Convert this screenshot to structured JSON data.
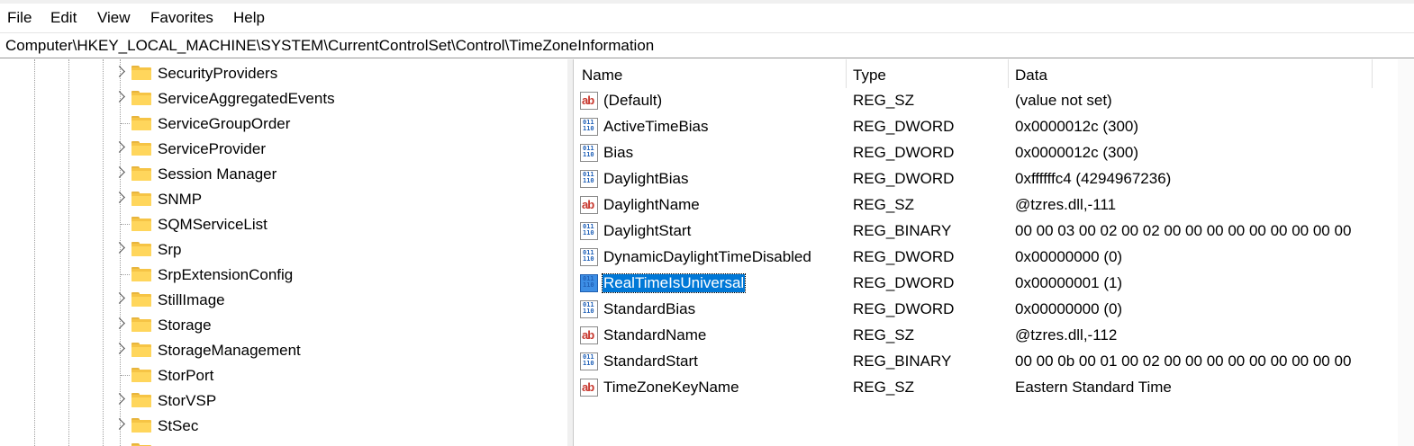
{
  "menu": [
    "File",
    "Edit",
    "View",
    "Favorites",
    "Help"
  ],
  "address": "Computer\\HKEY_LOCAL_MACHINE\\SYSTEM\\CurrentControlSet\\Control\\TimeZoneInformation",
  "tree": {
    "items": [
      {
        "label": "SecurityProviders",
        "expandable": true
      },
      {
        "label": "ServiceAggregatedEvents",
        "expandable": true
      },
      {
        "label": "ServiceGroupOrder",
        "expandable": false
      },
      {
        "label": "ServiceProvider",
        "expandable": true
      },
      {
        "label": "Session Manager",
        "expandable": true
      },
      {
        "label": "SNMP",
        "expandable": true
      },
      {
        "label": "SQMServiceList",
        "expandable": false
      },
      {
        "label": "Srp",
        "expandable": true
      },
      {
        "label": "SrpExtensionConfig",
        "expandable": false
      },
      {
        "label": "StillImage",
        "expandable": true
      },
      {
        "label": "Storage",
        "expandable": true
      },
      {
        "label": "StorageManagement",
        "expandable": true
      },
      {
        "label": "StorPort",
        "expandable": false
      },
      {
        "label": "StorVSP",
        "expandable": true
      },
      {
        "label": "StSec",
        "expandable": true
      }
    ]
  },
  "list": {
    "columns": [
      "Name",
      "Type",
      "Data"
    ],
    "rows": [
      {
        "name": "(Default)",
        "type": "REG_SZ",
        "data": "(value not set)",
        "icon": "string-value-icon"
      },
      {
        "name": "ActiveTimeBias",
        "type": "REG_DWORD",
        "data": "0x0000012c (300)",
        "icon": "binary-value-icon"
      },
      {
        "name": "Bias",
        "type": "REG_DWORD",
        "data": "0x0000012c (300)",
        "icon": "binary-value-icon"
      },
      {
        "name": "DaylightBias",
        "type": "REG_DWORD",
        "data": "0xffffffc4 (4294967236)",
        "icon": "binary-value-icon"
      },
      {
        "name": "DaylightName",
        "type": "REG_SZ",
        "data": "@tzres.dll,-111",
        "icon": "string-value-icon"
      },
      {
        "name": "DaylightStart",
        "type": "REG_BINARY",
        "data": "00 00 03 00 02 00 02 00 00 00 00 00 00 00 00 00",
        "icon": "binary-value-icon"
      },
      {
        "name": "DynamicDaylightTimeDisabled",
        "type": "REG_DWORD",
        "data": "0x00000000 (0)",
        "icon": "binary-value-icon"
      },
      {
        "name": "RealTimeIsUniversal",
        "type": "REG_DWORD",
        "data": "0x00000001 (1)",
        "icon": "binary-value-icon",
        "selected": true
      },
      {
        "name": "StandardBias",
        "type": "REG_DWORD",
        "data": "0x00000000 (0)",
        "icon": "binary-value-icon"
      },
      {
        "name": "StandardName",
        "type": "REG_SZ",
        "data": "@tzres.dll,-112",
        "icon": "string-value-icon"
      },
      {
        "name": "StandardStart",
        "type": "REG_BINARY",
        "data": "00 00 0b 00 01 00 02 00 00 00 00 00 00 00 00 00",
        "icon": "binary-value-icon"
      },
      {
        "name": "TimeZoneKeyName",
        "type": "REG_SZ",
        "data": "Eastern Standard Time",
        "icon": "string-value-icon"
      }
    ]
  },
  "colors": {
    "selection": "#0078d7",
    "folder": "#f6c445"
  },
  "icon_glyphs": {
    "string": "ab",
    "binary": "011\n110"
  }
}
